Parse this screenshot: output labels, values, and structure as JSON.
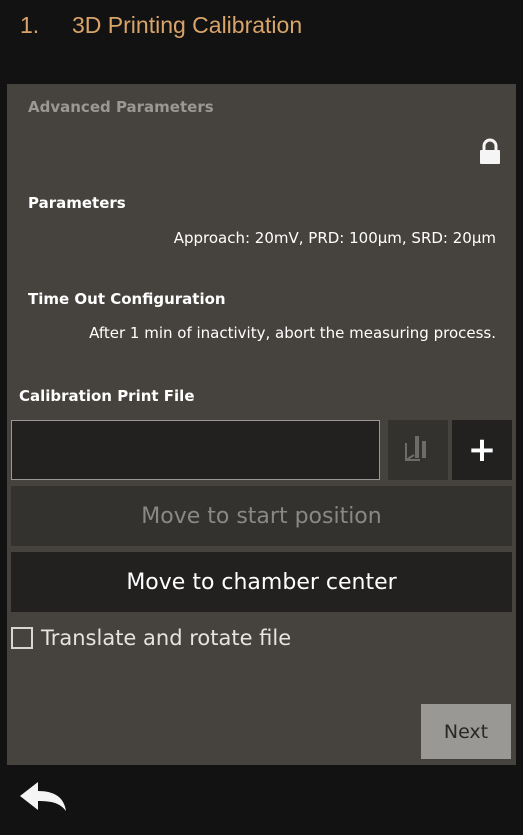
{
  "header": {
    "step": "1.",
    "title": "3D Printing Calibration"
  },
  "advanced": {
    "heading": "Advanced Parameters",
    "lock_icon": "lock-icon"
  },
  "parameters": {
    "label": "Parameters",
    "value": "Approach: 20mV, PRD: 100µm, SRD: 20µm"
  },
  "timeout": {
    "label": "Time Out Configuration",
    "value": "After 1 min of inactivity, abort the measuring process."
  },
  "file": {
    "label": "Calibration Print File",
    "value": ""
  },
  "buttons": {
    "start": "Move to start position",
    "center": "Move to chamber center",
    "next": "Next",
    "plus": "+"
  },
  "checkbox": {
    "label": "Translate and rotate file",
    "checked": false
  },
  "colors": {
    "accent": "#d9a46a",
    "panel": "#46423d",
    "background": "#121212"
  }
}
